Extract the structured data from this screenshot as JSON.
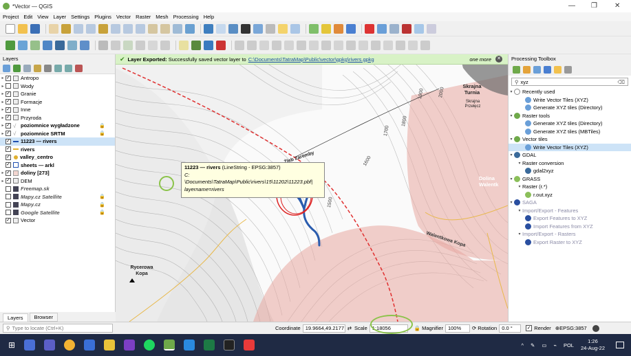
{
  "window": {
    "title": "*Vector — QGIS"
  },
  "menu": [
    "Project",
    "Edit",
    "View",
    "Layer",
    "Settings",
    "Plugins",
    "Vector",
    "Raster",
    "Mesh",
    "Processing",
    "Help"
  ],
  "message": {
    "title": "Layer Exported:",
    "text": "Successfully saved vector layer to",
    "link": "C:\\Documents\\TatraMap\\Public\\vector\\gpkg\\rivers.gpkg",
    "more": "one more"
  },
  "layers": {
    "header": "Layers",
    "items": [
      {
        "label": "Antropo",
        "checked": true,
        "style": "normal"
      },
      {
        "label": "Wody",
        "checked": false,
        "style": "normal"
      },
      {
        "label": "Granie",
        "checked": true,
        "style": "normal"
      },
      {
        "label": "Formacje",
        "checked": true,
        "style": "normal"
      },
      {
        "label": "Inne",
        "checked": true,
        "style": "normal"
      },
      {
        "label": "Przyroda",
        "checked": true,
        "style": "normal"
      },
      {
        "label": "poziomnice wygładzone",
        "checked": true,
        "style": "bold"
      },
      {
        "label": "poziomnice SRTM",
        "checked": true,
        "style": "bold"
      },
      {
        "label": "11223 — rivers",
        "checked": true,
        "style": "bold"
      },
      {
        "label": "rivers",
        "checked": true,
        "style": "bold"
      },
      {
        "label": "valley_centro",
        "checked": true,
        "style": "bold"
      },
      {
        "label": "sheets — arkl",
        "checked": true,
        "style": "bold"
      },
      {
        "label": "doliny [273]",
        "checked": true,
        "style": "bold"
      },
      {
        "label": "DEM",
        "checked": true,
        "style": "normal"
      },
      {
        "label": "Freemap.sk",
        "checked": false,
        "style": "italic"
      },
      {
        "label": "Mapy.cz Satellite",
        "checked": false,
        "style": "italic"
      },
      {
        "label": "Mapy.cz",
        "checked": false,
        "style": "italic"
      },
      {
        "label": "Google Satellite",
        "checked": false,
        "style": "italic"
      },
      {
        "label": "Vector",
        "checked": true,
        "style": "normal"
      }
    ],
    "tabs": [
      "Layers",
      "Browser"
    ]
  },
  "tooltip": {
    "title": "11223 — rivers",
    "subtitle": "(LineString - EPSG:3857)",
    "line1": "C:",
    "line2": "\\Documents\\TatraMap\\Public\\rivers\\15\\11202\\11223.pbf|",
    "line3": "layername=rivers"
  },
  "map_labels": {
    "skrajna_turnia": "Skrajna Turnia",
    "skrajna_przelecz": "Skrajna Przełęcz",
    "zleb": "Żleb Zaremby",
    "dolina": "Dolina Walentk",
    "walentkowa": "Walentkowa Kopa",
    "rycerowa": "Rycerowa Kopa",
    "c1900": "1900",
    "c2000": "2000",
    "c1800": "1800",
    "c1700": "1700",
    "c1600": "1600",
    "c1500": "1500",
    "c1400": "1400"
  },
  "processing": {
    "header": "Processing Toolbox",
    "search": "xyz",
    "tree": [
      {
        "level": 0,
        "label": "Recently used",
        "kind": "group"
      },
      {
        "level": 2,
        "label": "Write Vector Tiles (XYZ)",
        "kind": "alg"
      },
      {
        "level": 2,
        "label": "Generate XYZ tiles (Directory)",
        "kind": "alg"
      },
      {
        "level": 0,
        "label": "Raster tools",
        "kind": "group"
      },
      {
        "level": 2,
        "label": "Generate XYZ tiles (Directory)",
        "kind": "alg"
      },
      {
        "level": 2,
        "label": "Generate XYZ tiles (MBTiles)",
        "kind": "alg"
      },
      {
        "level": 0,
        "label": "Vector tiles",
        "kind": "group"
      },
      {
        "level": 2,
        "label": "Write Vector Tiles (XYZ)",
        "kind": "alg-sel"
      },
      {
        "level": 0,
        "label": "GDAL",
        "kind": "group"
      },
      {
        "level": 1,
        "label": "Raster conversion",
        "kind": "sub"
      },
      {
        "level": 2,
        "label": "gdal2xyz",
        "kind": "alg"
      },
      {
        "level": 0,
        "label": "GRASS",
        "kind": "group"
      },
      {
        "level": 1,
        "label": "Raster (r.*)",
        "kind": "sub"
      },
      {
        "level": 2,
        "label": "r.out.xyz",
        "kind": "alg"
      },
      {
        "level": 0,
        "label": "SAGA",
        "kind": "group-dim"
      },
      {
        "level": 1,
        "label": "Import/Export - Features",
        "kind": "sub-dim"
      },
      {
        "level": 2,
        "label": "Export Features to XYZ",
        "kind": "alg-dim"
      },
      {
        "level": 2,
        "label": "Import Features from XYZ",
        "kind": "alg-dim"
      },
      {
        "level": 1,
        "label": "Import/Export - Rasters",
        "kind": "sub-dim"
      },
      {
        "level": 2,
        "label": "Export Raster to XYZ",
        "kind": "alg-dim"
      }
    ]
  },
  "status": {
    "locate_placeholder": "Type to locate (Ctrl+K)",
    "coordinate_label": "Coordinate",
    "coordinate": "19.9664,49.2177",
    "scale_label": "Scale",
    "scale": "1:18056",
    "magnifier_label": "Magnifier",
    "magnifier": "100%",
    "rotation_label": "Rotation",
    "rotation": "0.0 °",
    "render": "Render",
    "crs": "EPSG:3857"
  },
  "taskbar": {
    "lang": "POL",
    "time": "1:26",
    "date": "24-Aug-22"
  }
}
